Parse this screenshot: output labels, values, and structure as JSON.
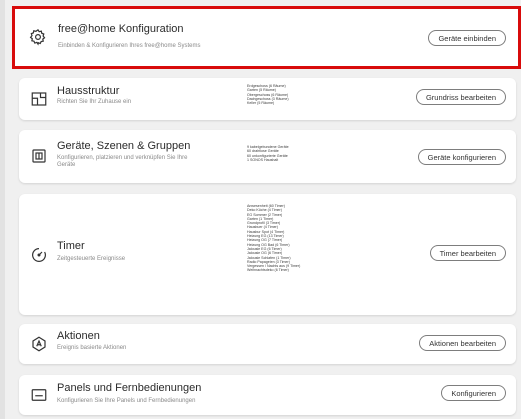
{
  "cards": [
    {
      "title": "free@home Konfiguration",
      "subtitle": "Einbinden & Konfigurieren Ihres free@home Systems",
      "button": "Geräte einbinden",
      "details": []
    },
    {
      "title": "Hausstruktur",
      "subtitle": "Richten Sie Ihr Zuhause ein",
      "button": "Grundriss bearbeiten",
      "details": [
        "Erdgeschoss (6 Räume)",
        "Garten (5 Räume)",
        "Obergeschoss (6 Räume)",
        "Dachgeschoss (3 Räume)",
        "Keller (5 Räume)"
      ]
    },
    {
      "title": "Geräte, Szenen & Gruppen",
      "subtitle": "Konfigurieren, platzieren und verknüpfen Sie Ihre",
      "subtitle2": "Geräte",
      "button": "Geräte konfigurieren",
      "details": [
        "9 kabelgebundene Geräte",
        "60 drahtlose Geräte",
        "60 unkonfigurierte Geräte",
        "1 SONOS Haushalt"
      ]
    },
    {
      "title": "Timer",
      "subtitle": "Zeitgesteuerte Ereignisse",
      "button": "Timer bearbeiten",
      "details": [
        "Anwesenheit (60 Timer)",
        "Deko Küche (4 Timer)",
        "EG Sommer (2 Timer)",
        "Garten (1 Timer)",
        "Grundprofil (3 Timer)",
        "Hausbuer (4 Timer)",
        "Hausbur Spot (4 Timer)",
        "Heizung EG (13 Timer)",
        "Heizung OG (7 Timer)",
        "Heizung OG Bad (6 Timer)",
        "Jalousie EG (6 Timer)",
        "Jalousie OG (6 Timer)",
        "Jalousie Schlafen (1 Timer)",
        "Radio Papageien (3 Timer)",
        "Vergessen / Nachts aus (9 Timer)",
        "Weihnachtsdeko (6 Timer)"
      ]
    },
    {
      "title": "Aktionen",
      "subtitle": "Ereignis basierte Aktionen",
      "button": "Aktionen bearbeiten",
      "details": []
    },
    {
      "title": "Panels und Fernbedienungen",
      "subtitle": "Konfigurieren Sie Ihre Panels und Fernbedienungen",
      "button": "Konfigurieren",
      "details": []
    }
  ],
  "icons": [
    "gear-icon",
    "floorplan-icon",
    "device-icon",
    "timer-icon",
    "action-icon",
    "panel-icon"
  ],
  "colors": {
    "highlight": "#d80b0b",
    "card": "#ffffff",
    "background": "#f0f0f0"
  }
}
